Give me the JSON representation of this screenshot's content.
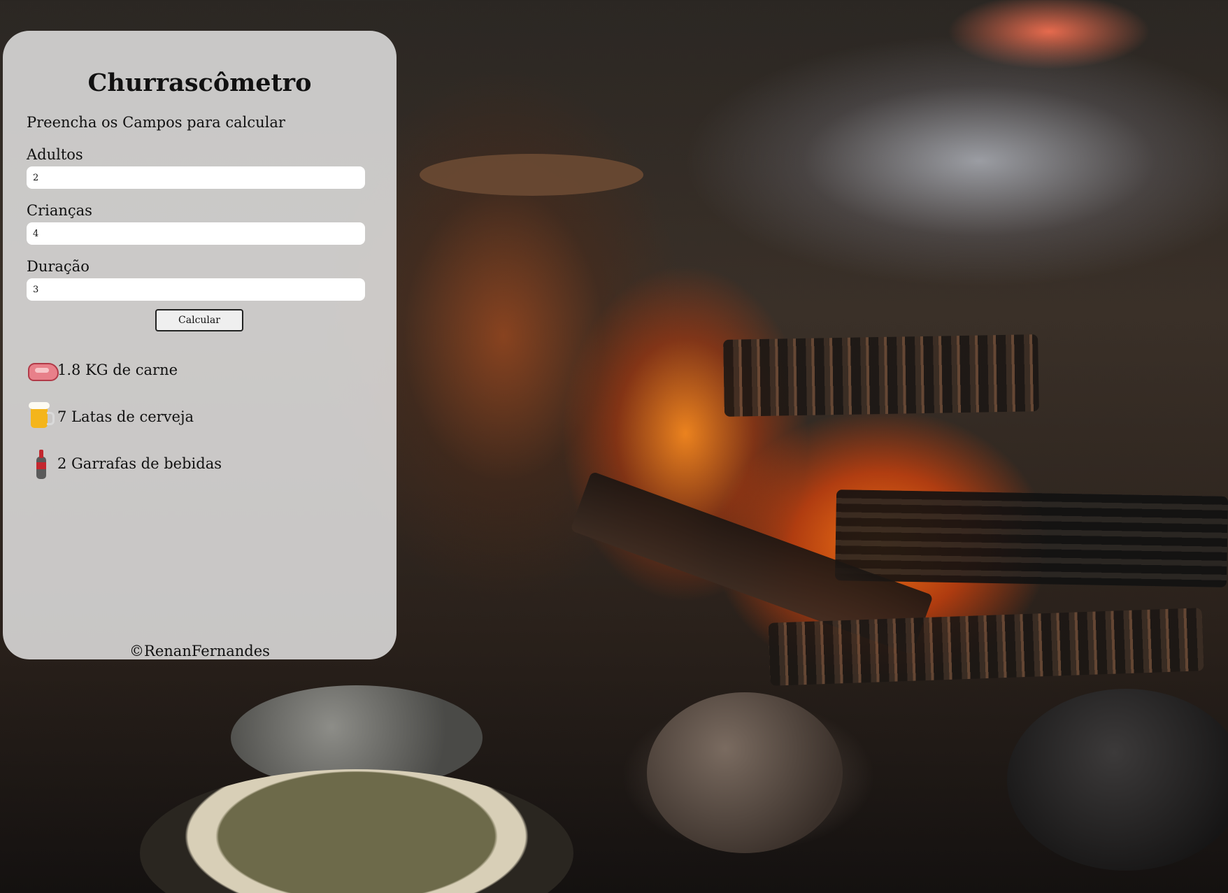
{
  "app": {
    "title": "Churrascômetro",
    "subtitle": "Preencha os Campos para calcular"
  },
  "form": {
    "adults": {
      "label": "Adultos",
      "value": "2"
    },
    "children": {
      "label": "Crianças",
      "value": "4"
    },
    "duration": {
      "label": "Duração",
      "value": "3"
    },
    "calculate_label": "Calcular"
  },
  "results": [
    {
      "icon": "steak-icon",
      "text": "1.8 KG de carne"
    },
    {
      "icon": "beer-mug-icon",
      "text": "7 Latas de cerveja"
    },
    {
      "icon": "bottle-icon",
      "text": "2 Garrafas de bebidas"
    }
  ],
  "footer": {
    "text": "©RenanFernandes"
  }
}
